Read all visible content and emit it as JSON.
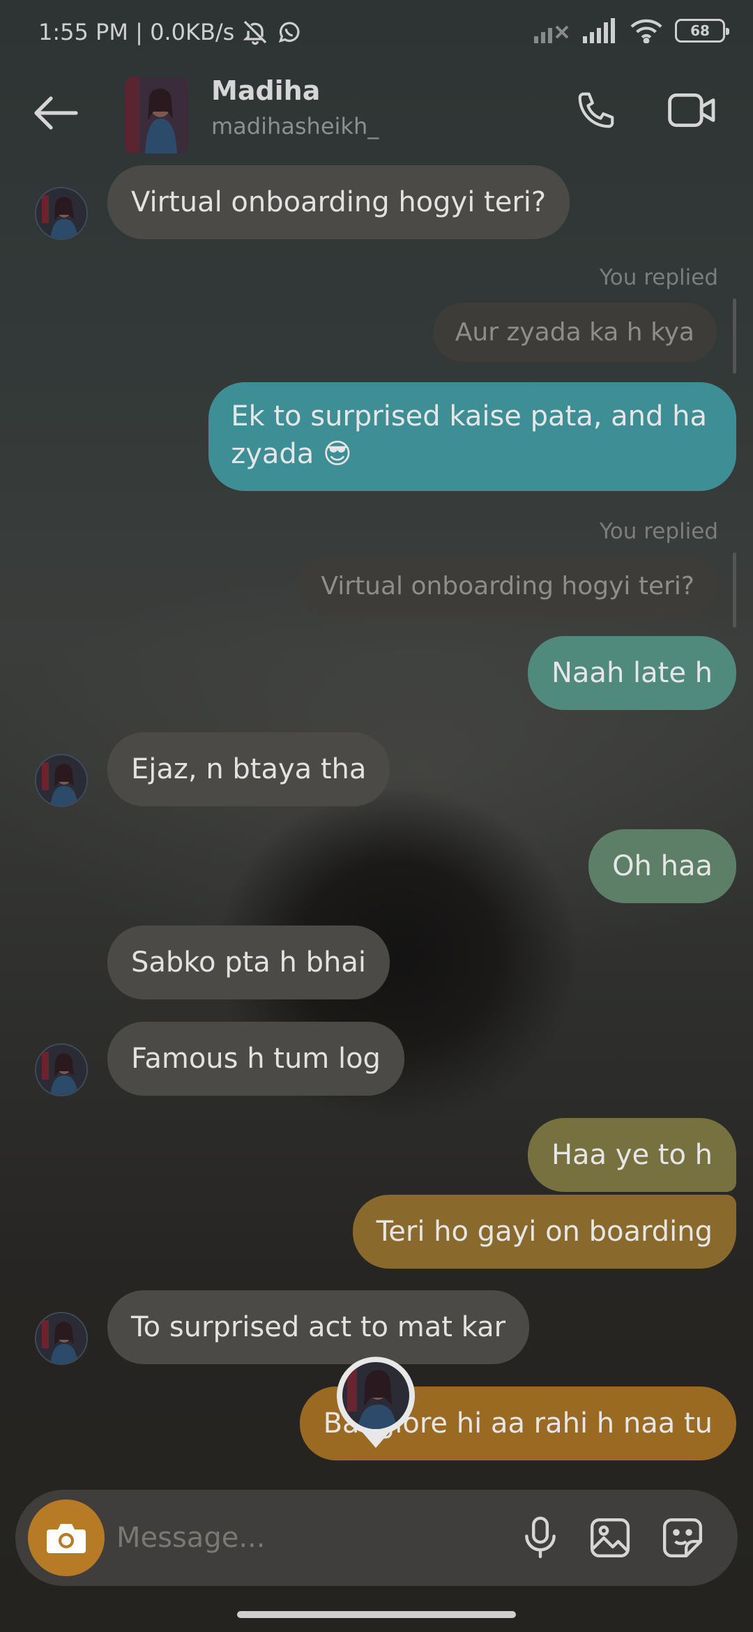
{
  "status": {
    "time_speed": "1:55 PM | 0.0KB/s",
    "battery": "68"
  },
  "header": {
    "name": "Madiha",
    "handle": "madihasheikh_"
  },
  "messages": [
    {
      "text": "Virtual onboarding hogyi teri?"
    },
    {
      "label": "You replied",
      "quote": "Aur zyada ka h kya"
    },
    {
      "text": "Ek to surprised kaise pata, and ha",
      "text2": "zyada 😎"
    },
    {
      "label": "You replied",
      "quote": "Virtual onboarding hogyi teri?"
    },
    {
      "text": "Naah late h"
    },
    {
      "text": "Ejaz, n btaya tha"
    },
    {
      "text": "Oh haa"
    },
    {
      "text": "Sabko pta h bhai"
    },
    {
      "text": "Famous h tum log"
    },
    {
      "text": "Haa ye to h"
    },
    {
      "text": "Teri ho gayi on boarding"
    },
    {
      "text": "To surprised act to mat kar"
    },
    {
      "text": "Banglore hi aa rahi h naa tu"
    }
  ],
  "composer": {
    "placeholder": "Message..."
  },
  "colors": {
    "teal": "#3d8f95",
    "green_teal": "#4f8a7d",
    "sage": "#5d7f67",
    "olive": "#77703f",
    "amber": "#8a6a2c",
    "orange": "#9a6a22",
    "incoming": "#4b4a47",
    "camera": "#b77a25"
  }
}
